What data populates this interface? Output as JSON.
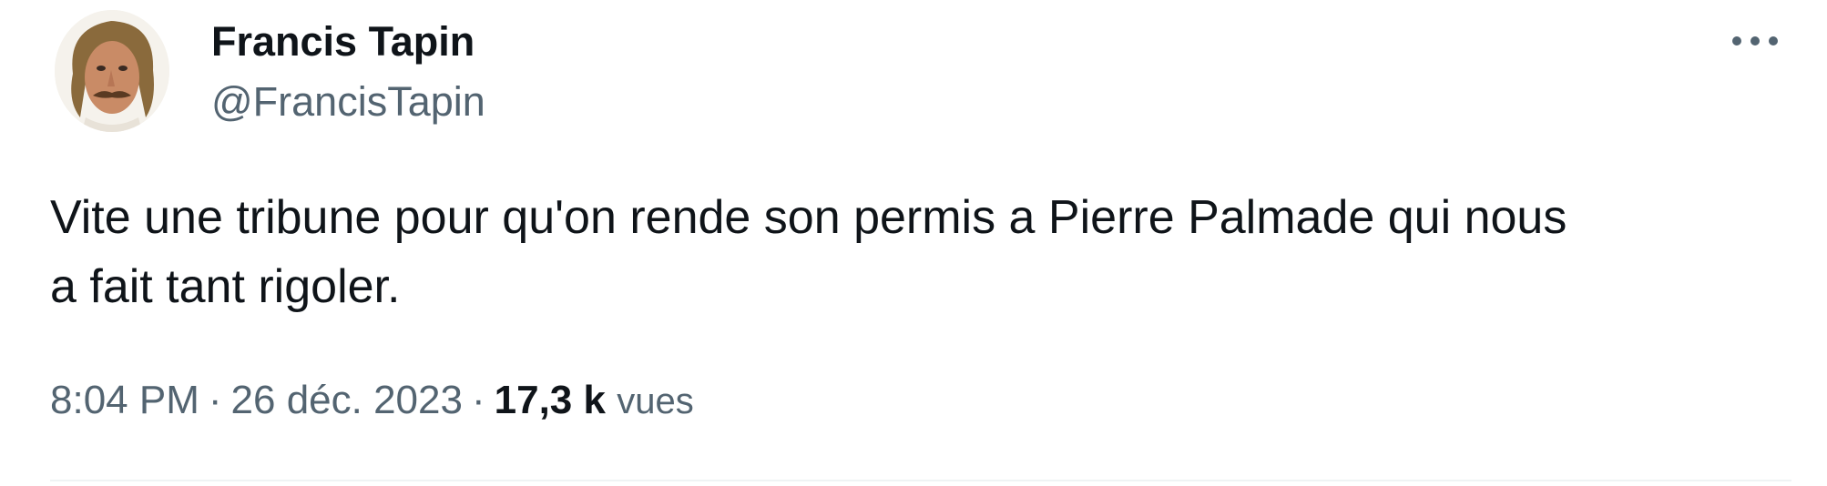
{
  "author": {
    "display_name": "Francis Tapin",
    "handle": "@FrancisTapin"
  },
  "tweet": {
    "text": "Vite une tribune pour qu'on rende son permis a Pierre Palmade qui nous\na fait tant rigoler."
  },
  "meta": {
    "time": "8:04 PM",
    "separator": "·",
    "date": "26 déc. 2023",
    "views_count": "17,3 k",
    "views_label": "vues"
  },
  "icons": {
    "more": "more-horizontal-icon"
  },
  "colors": {
    "text_primary": "#0f1419",
    "text_secondary": "#536471",
    "divider": "#eff3f4"
  }
}
